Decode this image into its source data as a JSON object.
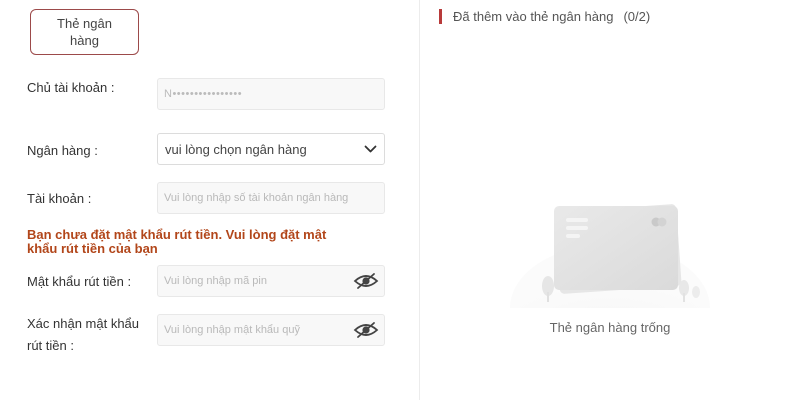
{
  "tab": {
    "label": "Thẻ ngân hàng"
  },
  "form": {
    "account_holder": {
      "label": "Chủ tài khoản :",
      "value": "N••••••••••••••••"
    },
    "bank": {
      "label": "Ngân hàng :",
      "value": "vui lòng chọn ngân hàng"
    },
    "account_number": {
      "label": "Tài khoản :",
      "placeholder": "Vui lòng nhập số tài khoản ngân hàng"
    },
    "warning": "Bạn chưa đặt mật khẩu rút tiền. Vui lòng đặt mật khẩu rút tiền của bạn",
    "withdraw_password": {
      "label": "Mật khẩu rút tiền :",
      "placeholder": "Vui lòng nhập mã pin"
    },
    "confirm_password": {
      "label_line1": "Xác nhận mật khẩu",
      "label_line2": "rút tiền :",
      "placeholder": "Vui lòng nhập mật khẩu quỹ"
    }
  },
  "panel": {
    "title": "Đã thêm vào thẻ ngân hàng",
    "count": "(0/2)",
    "empty_text": "Thẻ ngân hàng trống",
    "accent_color": "#b83a3a"
  }
}
